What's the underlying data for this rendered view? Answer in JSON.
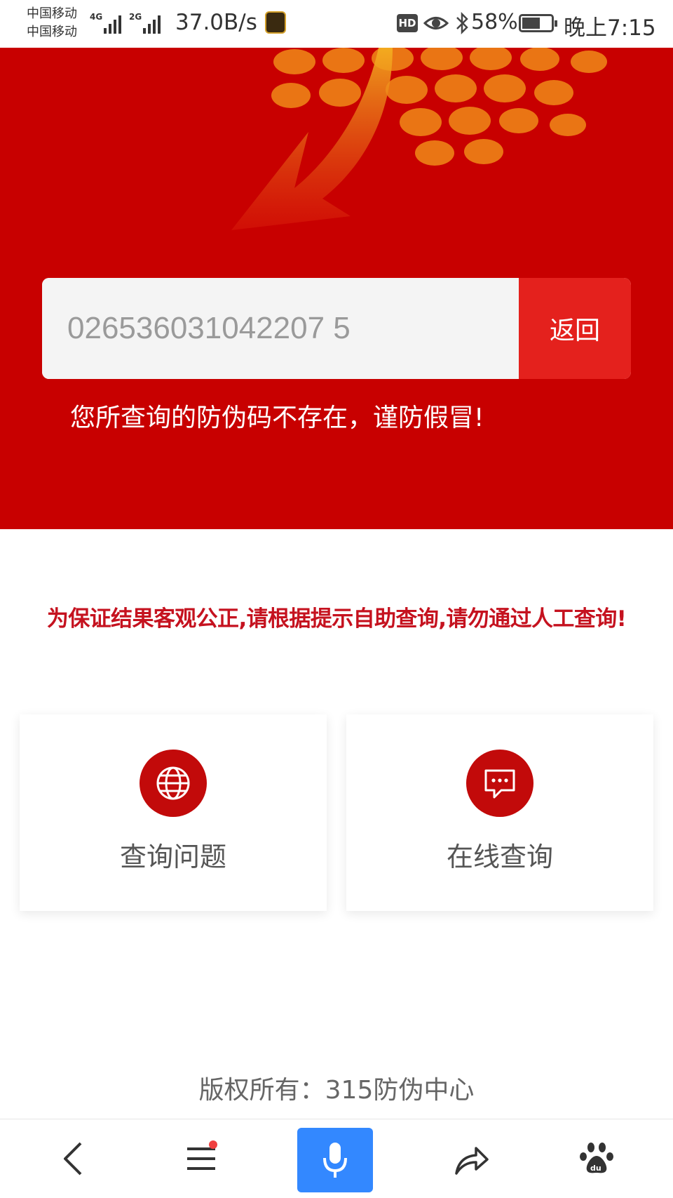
{
  "status_bar": {
    "carrier_1": "中国移动",
    "carrier_2": "中国移动",
    "network_1": "4G",
    "network_2": "2G",
    "net_speed": "37.0B/s",
    "hd_label": "HD",
    "battery_percent": "58%",
    "battery_level": 0.58,
    "time": "晚上7:15"
  },
  "query": {
    "code_value": "026536031042207 5",
    "back_label": "返回",
    "result_message": "您所查询的防伪码不存在，谨防假冒!"
  },
  "notice": "为保证结果客观公正,请根据提示自助查询,请勿通过人工查询!",
  "cards": [
    {
      "label": "查询问题",
      "icon": "globe-icon"
    },
    {
      "label": "在线查询",
      "icon": "chat-bubble-icon"
    }
  ],
  "footer": {
    "copyright": "版权所有：315防伪中心"
  },
  "bottom_nav": {
    "items": [
      "back-icon",
      "menu-icon",
      "microphone-icon",
      "share-icon",
      "baidu-paw-icon"
    ],
    "accent": "#3388ff"
  },
  "colors": {
    "brand_red": "#c80000",
    "button_red": "#e4211d",
    "notice_red": "#c5121f"
  }
}
